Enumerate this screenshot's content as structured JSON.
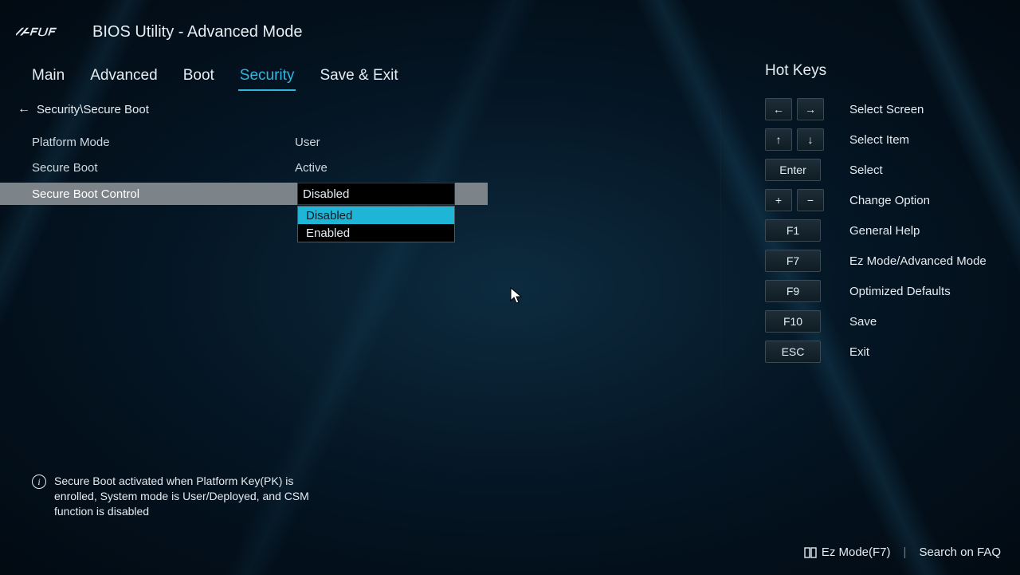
{
  "brand": "ASUS",
  "header": {
    "title": "BIOS Utility - Advanced Mode"
  },
  "tabs": [
    {
      "label": "Main",
      "active": false
    },
    {
      "label": "Advanced",
      "active": false
    },
    {
      "label": "Boot",
      "active": false
    },
    {
      "label": "Security",
      "active": true
    },
    {
      "label": "Save & Exit",
      "active": false
    }
  ],
  "breadcrumb": "Security\\Secure Boot",
  "settings": {
    "platform_mode": {
      "label": "Platform Mode",
      "value": "User"
    },
    "secure_boot": {
      "label": "Secure Boot",
      "value": "Active"
    },
    "secure_boot_control": {
      "label": "Secure Boot Control",
      "value": "Disabled",
      "options": [
        "Disabled",
        "Enabled"
      ],
      "highlighted_option": "Disabled"
    }
  },
  "help_text": "Secure Boot activated when Platform Key(PK) is enrolled, System mode is User/Deployed, and CSM function is disabled",
  "sidebar": {
    "title": "Hot Keys",
    "rows": [
      {
        "keys": [
          "←",
          "→"
        ],
        "desc": "Select Screen"
      },
      {
        "keys": [
          "↑",
          "↓"
        ],
        "desc": "Select Item"
      },
      {
        "keys": [
          "Enter"
        ],
        "desc": "Select",
        "wide": true
      },
      {
        "keys": [
          "+",
          "−"
        ],
        "desc": "Change Option"
      },
      {
        "keys": [
          "F1"
        ],
        "desc": "General Help",
        "wide": true
      },
      {
        "keys": [
          "F7"
        ],
        "desc": "Ez Mode/Advanced Mode",
        "wide": true
      },
      {
        "keys": [
          "F9"
        ],
        "desc": "Optimized Defaults",
        "wide": true
      },
      {
        "keys": [
          "F10"
        ],
        "desc": "Save",
        "wide": true
      },
      {
        "keys": [
          "ESC"
        ],
        "desc": "Exit",
        "wide": true
      }
    ]
  },
  "footer": {
    "ezmode": "Ez Mode(F7)",
    "search": "Search on FAQ"
  }
}
